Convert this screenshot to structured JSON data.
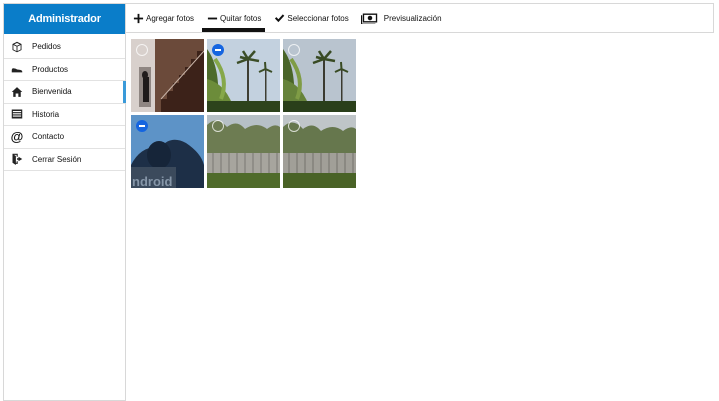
{
  "sidebar": {
    "title": "Administrador",
    "items": [
      {
        "label": "Pedidos",
        "icon": "box-icon"
      },
      {
        "label": "Productos",
        "icon": "shoe-icon"
      },
      {
        "label": "Bienvenida",
        "icon": "home-icon",
        "active": true
      },
      {
        "label": "Historia",
        "icon": "list-icon"
      },
      {
        "label": "Contacto",
        "icon": "at-icon"
      },
      {
        "label": "Cerrar Sesión",
        "icon": "logout-icon"
      }
    ]
  },
  "toolbar": {
    "add_label": "Agregar fotos",
    "remove_label": "Quitar fotos",
    "select_label": "Seleccionar fotos",
    "preview_label": "Previsualización",
    "active": "remove"
  },
  "gallery": {
    "photos": [
      {
        "subject": "stairs",
        "selected": false
      },
      {
        "subject": "palm-trees",
        "selected": true
      },
      {
        "subject": "palm-trees",
        "selected": false
      },
      {
        "subject": "android-statue",
        "selected": true
      },
      {
        "subject": "fence-trees",
        "selected": false
      },
      {
        "subject": "fence-trees",
        "selected": false
      }
    ]
  },
  "colors": {
    "header": "#0a7dc9",
    "active_indicator": "#3a9ad9",
    "select_badge": "#1565e0"
  }
}
